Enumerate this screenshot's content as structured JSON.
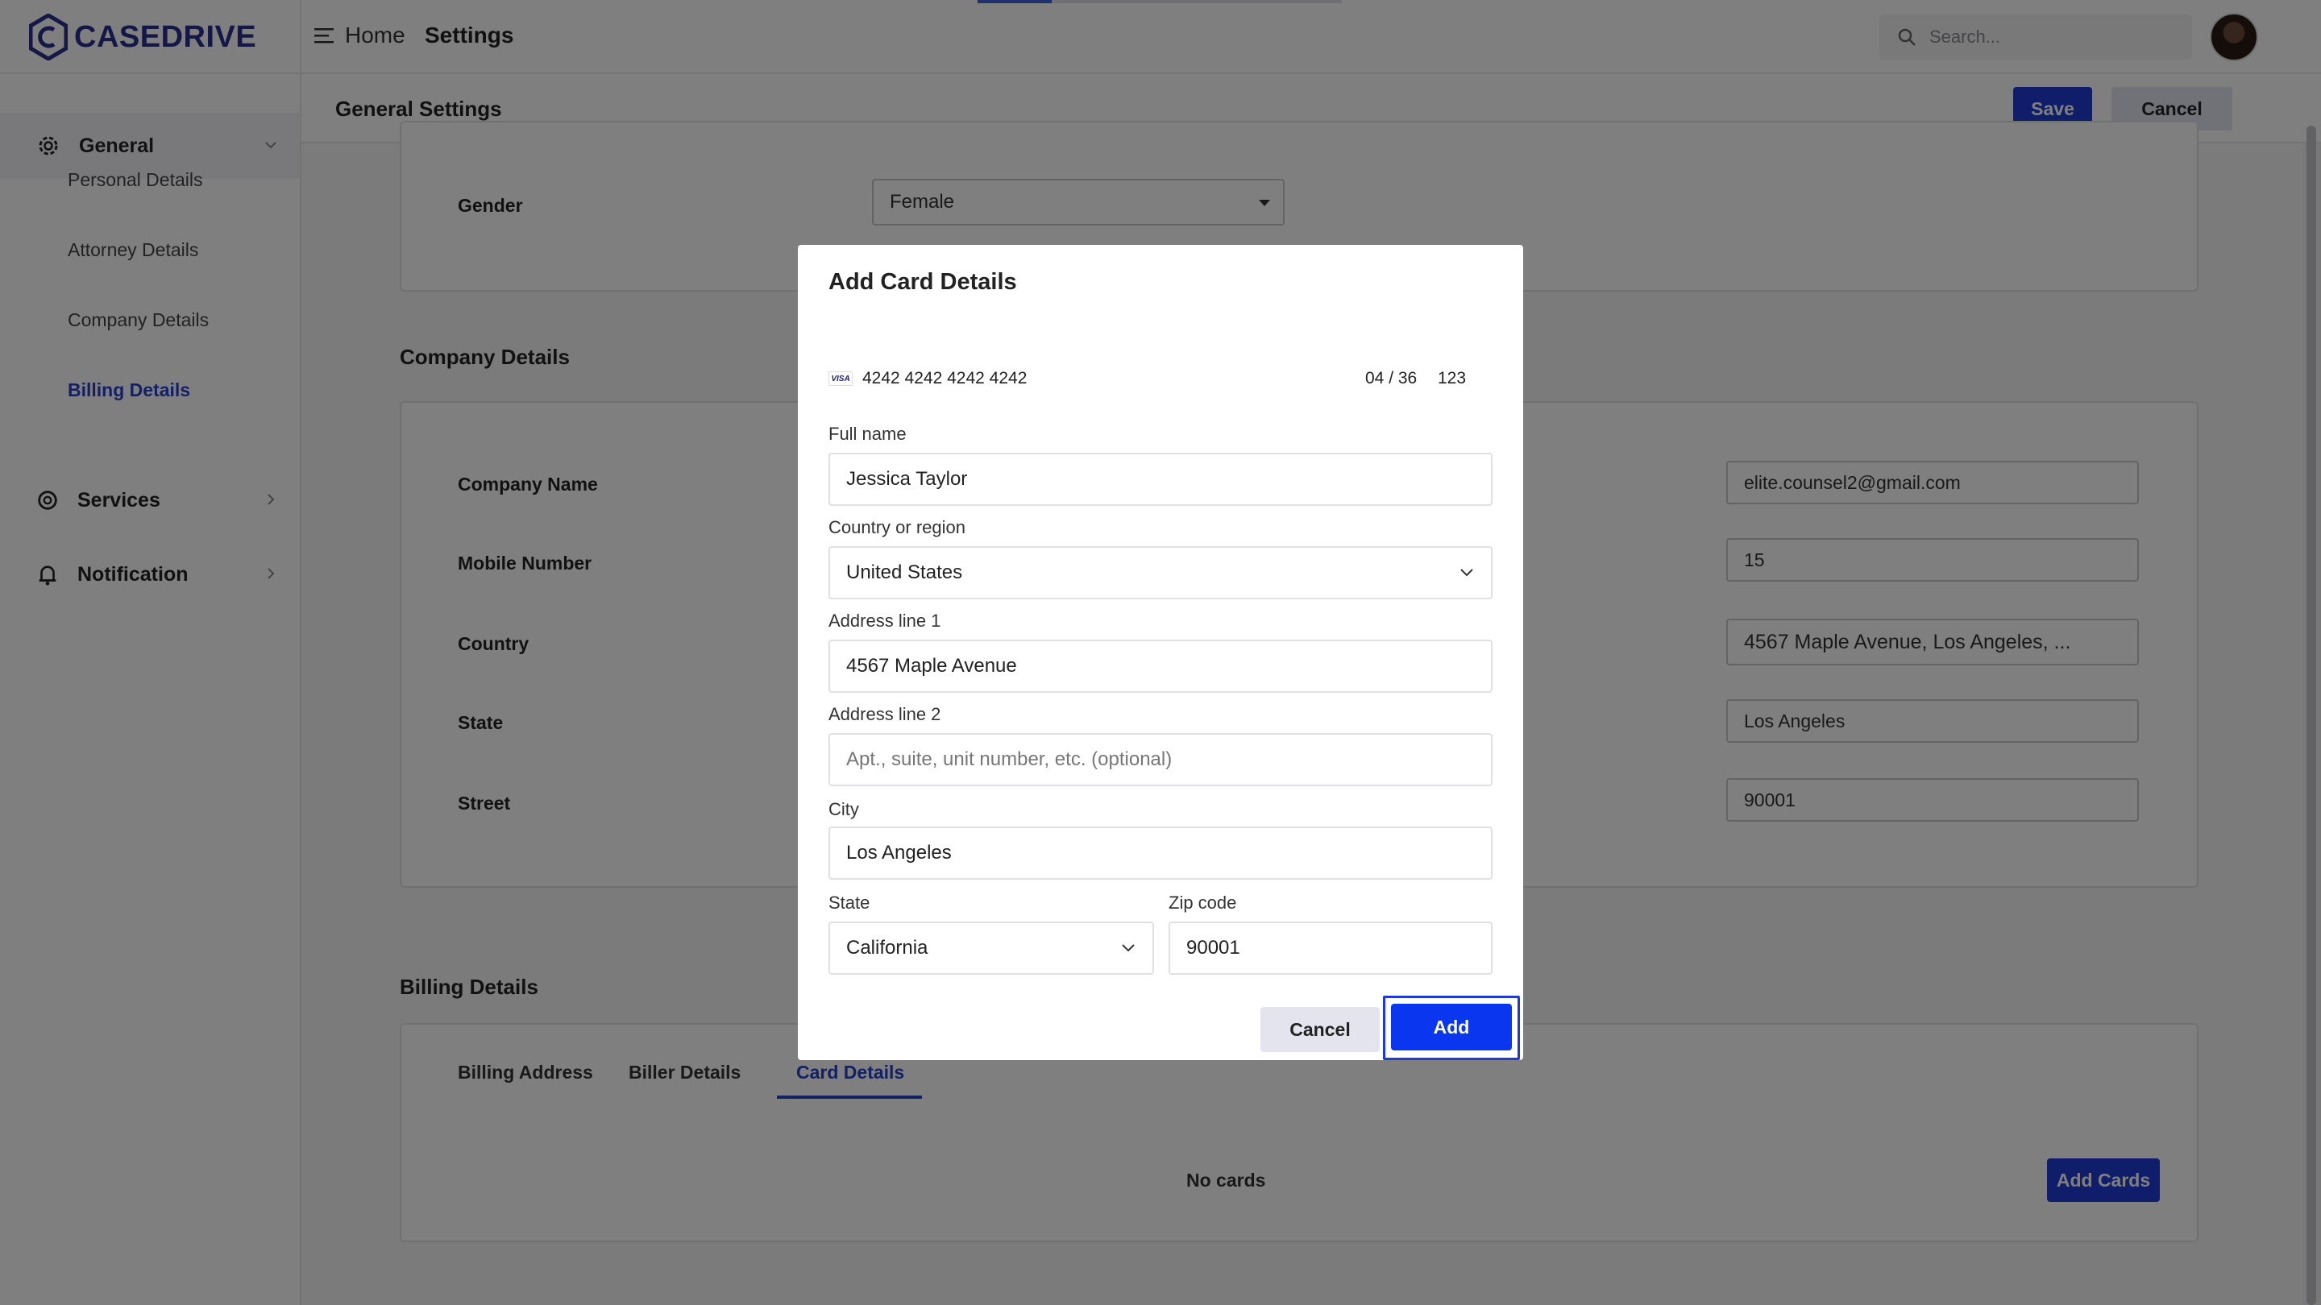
{
  "app": {
    "brand": "CASEDRIVE",
    "brand_color": "#2a2f8f",
    "accent": "#1f3bd6"
  },
  "topbar": {
    "nav_home": "Home",
    "nav_settings": "Settings",
    "search_placeholder": "Search..."
  },
  "sidebar": {
    "groups": [
      {
        "label": "General",
        "icon": "gear-icon",
        "expanded": true
      },
      {
        "label": "Services",
        "icon": "cog-icon"
      },
      {
        "label": "Notification",
        "icon": "bell-icon"
      }
    ],
    "sub_items": [
      "Personal Details",
      "Attorney Details",
      "Company Details",
      "Billing Details"
    ],
    "current_sub_item": "Billing Details"
  },
  "header": {
    "title": "General Settings",
    "save_label": "Save",
    "cancel_label": "Cancel"
  },
  "content": {
    "gender_label": "Gender",
    "gender_value": "Female",
    "company_section_title": "Company Details",
    "company_fields": [
      "Company Name",
      "Mobile Number",
      "Country",
      "State",
      "Street"
    ],
    "right_values": [
      "elite.counsel2@gmail.com",
      "15",
      "4567 Maple Avenue, Los Angeles, ...",
      "Los Angeles",
      "90001"
    ],
    "billing_section_title": "Billing Details",
    "tabs": [
      "Billing Address",
      "Biller Details",
      "Card Details"
    ],
    "active_tab": "Card Details",
    "no_cards": "No cards",
    "add_cards_label": "Add Cards"
  },
  "modal": {
    "title": "Add Card Details",
    "card_brand": "VISA",
    "card_number": "4242 4242 4242 4242",
    "card_expiry": "04 / 36",
    "card_cvc": "123",
    "full_name_label": "Full name",
    "full_name_value": "Jessica Taylor",
    "country_label": "Country or region",
    "country_value": "United States",
    "address1_label": "Address line 1",
    "address1_value": "4567 Maple Avenue",
    "address2_label": "Address line 2",
    "address2_placeholder": "Apt., suite, unit number, etc. (optional)",
    "city_label": "City",
    "city_value": "Los Angeles",
    "state_label": "State",
    "state_value": "California",
    "zip_label": "Zip code",
    "zip_value": "90001",
    "cancel_label": "Cancel",
    "add_label": "Add"
  }
}
